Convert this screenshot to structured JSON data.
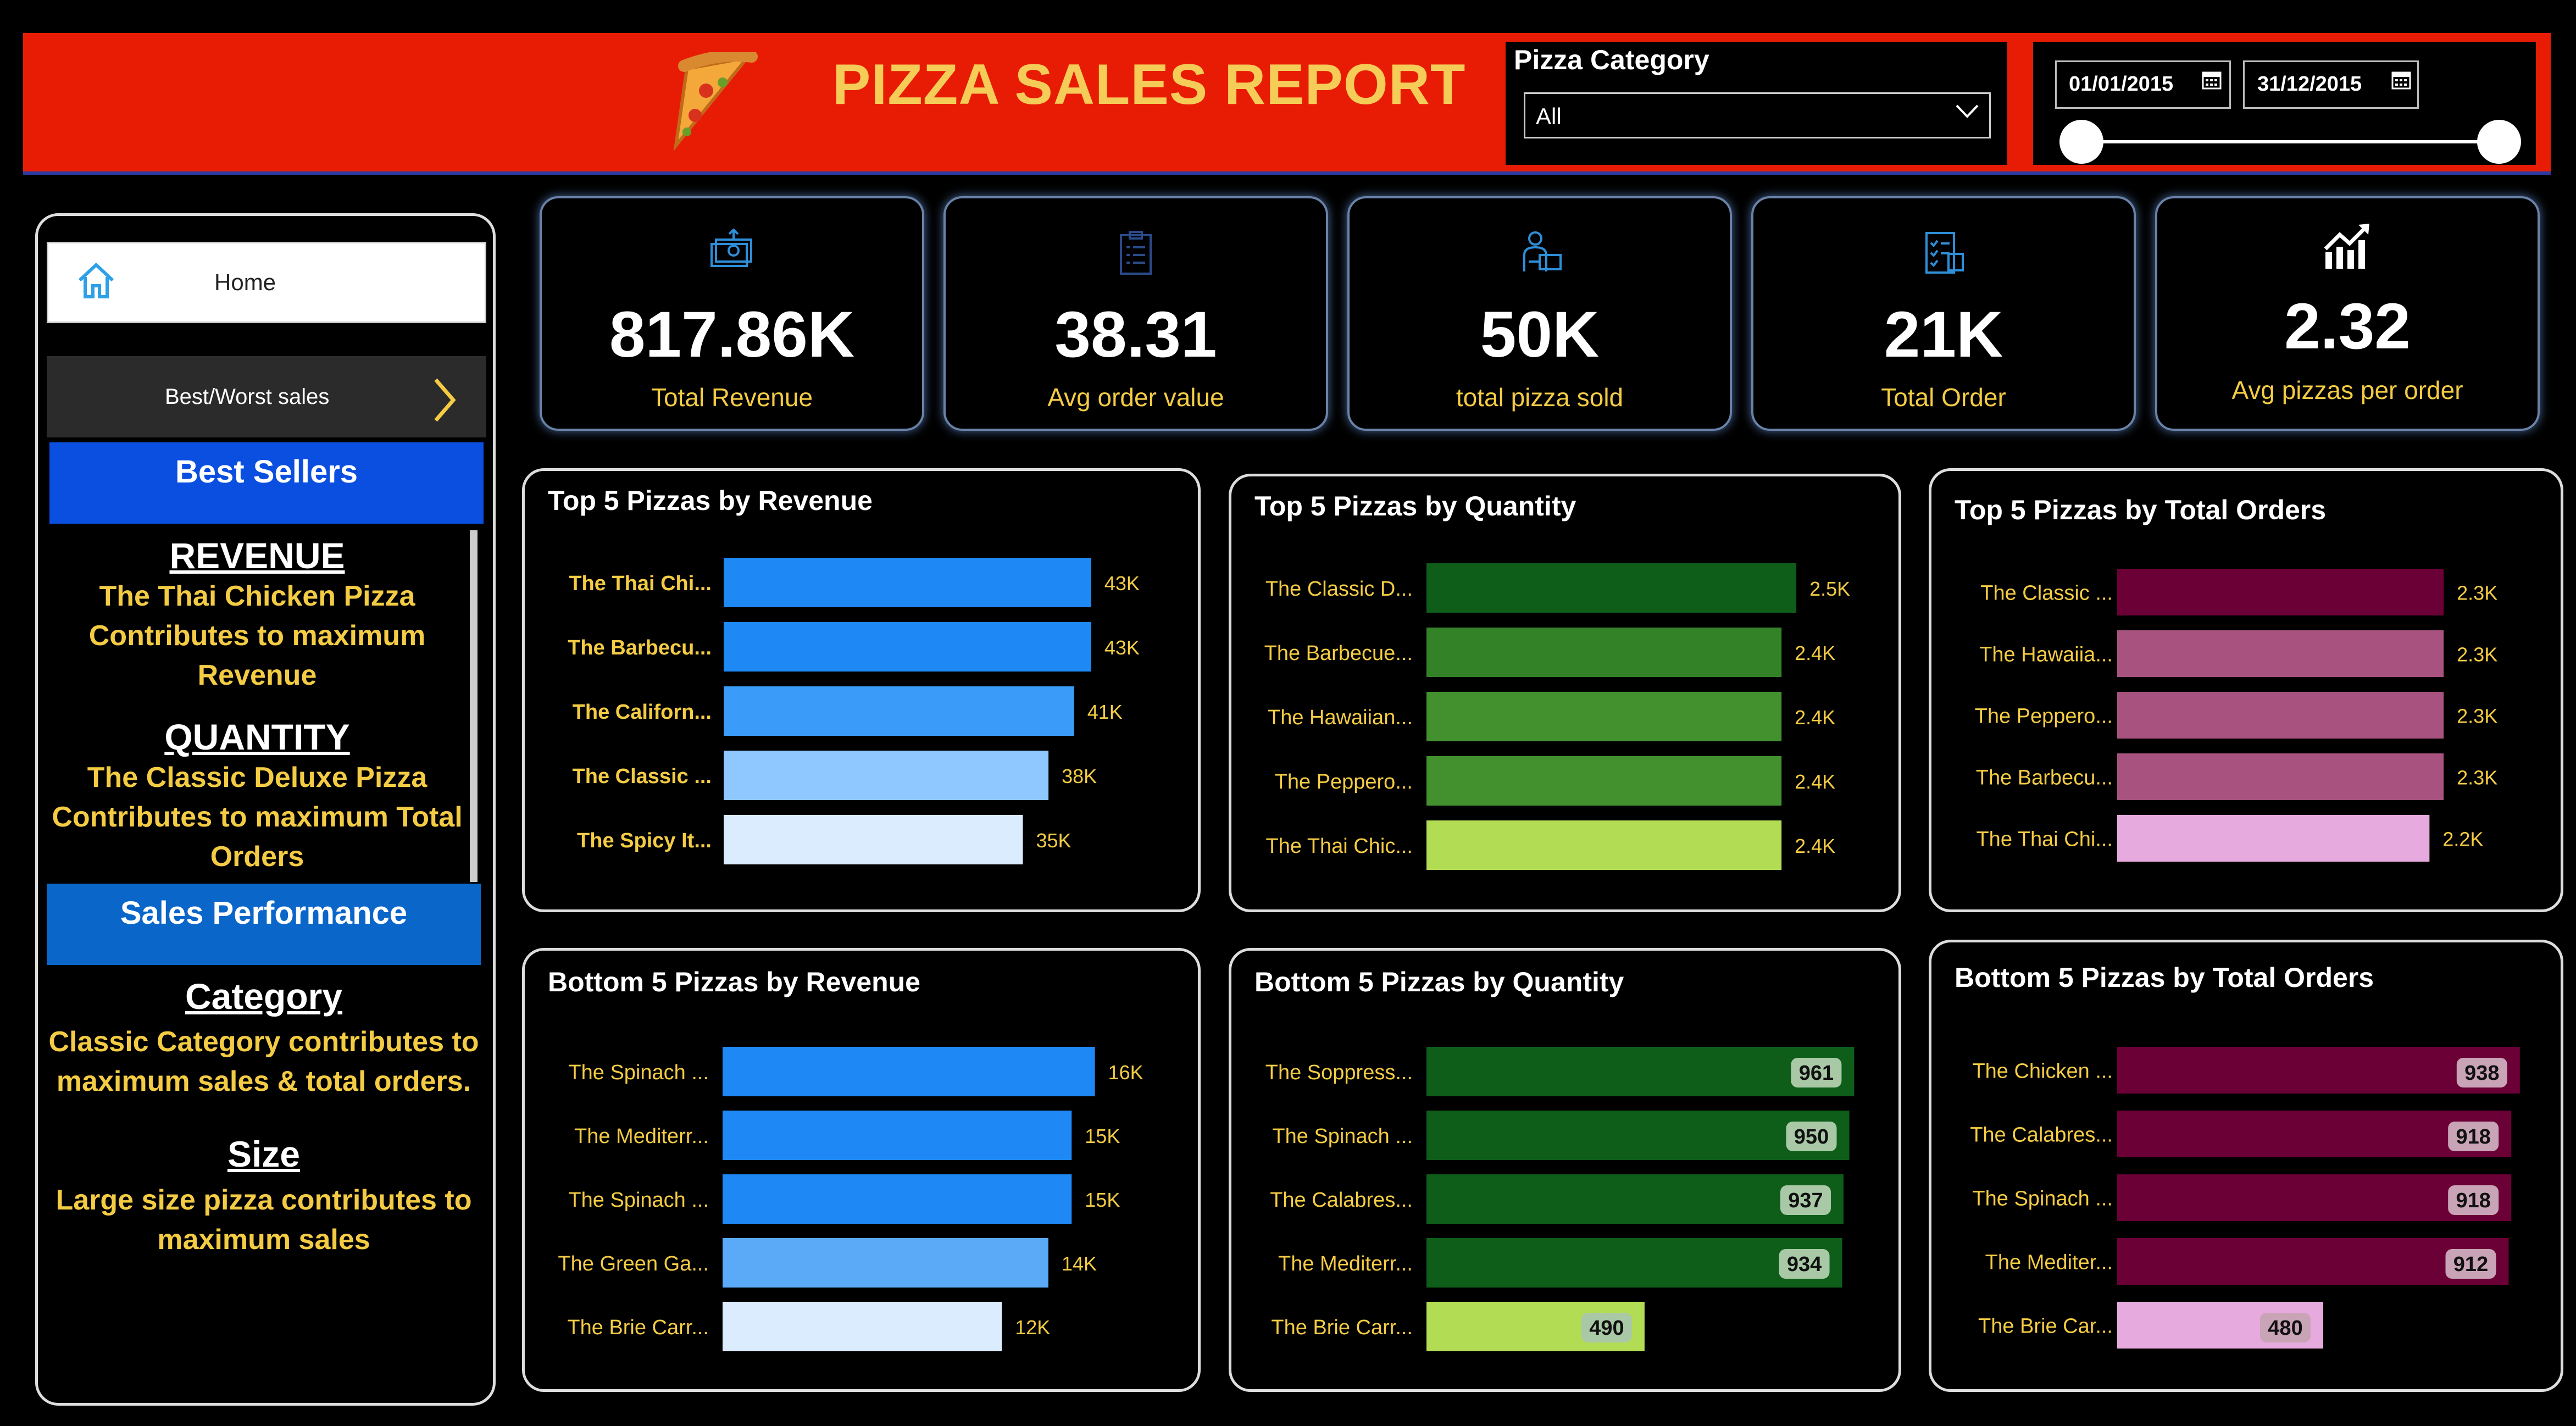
{
  "header": {
    "title": "PIZZA SALES REPORT",
    "category_filter": {
      "label": "Pizza Category",
      "selected": "All"
    },
    "date_range": {
      "start": "01/01/2015",
      "end": "31/12/2015"
    }
  },
  "sidebar": {
    "home_label": "Home",
    "best_worst_label": "Best/Worst sales",
    "best_sellers_label": "Best Sellers",
    "revenue_heading": "REVENUE",
    "revenue_text": "The Thai Chicken Pizza Contributes to maximum Revenue",
    "quantity_heading": "QUANTITY",
    "quantity_text": "The Classic Deluxe Pizza Contributes to maximum Total Orders",
    "sales_performance_label": "Sales Performance",
    "category_heading": "Category",
    "category_text": "Classic Category contributes to maximum sales & total orders.",
    "size_heading": "Size",
    "size_text": "Large size pizza contributes to maximum sales"
  },
  "kpis": [
    {
      "value": "817.86K",
      "label": "Total Revenue",
      "icon": "money-icon"
    },
    {
      "value": "38.31",
      "label": "Avg order value",
      "icon": "clipboard-icon"
    },
    {
      "value": "50K",
      "label": "total pizza sold",
      "icon": "delivery-icon"
    },
    {
      "value": "21K",
      "label": "Total Order",
      "icon": "checklist-icon"
    },
    {
      "value": "2.32",
      "label": "Avg pizzas per order",
      "icon": "growth-chart-icon"
    }
  ],
  "chart_data": [
    {
      "type": "bar",
      "orientation": "horizontal",
      "title": "Top 5 Pizzas by Revenue",
      "categories": [
        "The Thai Chi...",
        "The Barbecu...",
        "The Californ...",
        "The Classic ...",
        "The Spicy It..."
      ],
      "values": [
        43000,
        43000,
        41000,
        38000,
        35000
      ],
      "labels": [
        "43K",
        "43K",
        "41K",
        "38K",
        "35K"
      ],
      "colors": [
        "#1e88f5",
        "#1e88f5",
        "#3a9cf8",
        "#8ec8ff",
        "#dcecff"
      ],
      "label_style": "plain",
      "label_bold": true
    },
    {
      "type": "bar",
      "orientation": "horizontal",
      "title": "Top 5 Pizzas by Quantity",
      "categories": [
        "The Classic D...",
        "The Barbecue...",
        "The Hawaiian...",
        "The Peppero...",
        "The Thai Chic..."
      ],
      "values": [
        2500,
        2400,
        2400,
        2400,
        2400
      ],
      "labels": [
        "2.5K",
        "2.4K",
        "2.4K",
        "2.4K",
        "2.4K"
      ],
      "colors": [
        "#0e5e1a",
        "#348228",
        "#42912e",
        "#42912e",
        "#b3dc55"
      ],
      "label_style": "plain",
      "label_bold": false
    },
    {
      "type": "bar",
      "orientation": "horizontal",
      "title": "Top 5 Pizzas by Total Orders",
      "categories": [
        "The Classic ...",
        "The Hawaiia...",
        "The Peppero...",
        "The Barbecu...",
        "The Thai Chi..."
      ],
      "values": [
        2300,
        2300,
        2300,
        2300,
        2200
      ],
      "labels": [
        "2.3K",
        "2.3K",
        "2.3K",
        "2.3K",
        "2.2K"
      ],
      "colors": [
        "#6b0036",
        "#a8527f",
        "#a8527f",
        "#a8527f",
        "#e6aade"
      ],
      "label_style": "plain",
      "label_bold": false
    },
    {
      "type": "bar",
      "orientation": "horizontal",
      "title": "Bottom 5 Pizzas by Revenue",
      "categories": [
        "The Spinach ...",
        "The Mediterr...",
        "The Spinach ...",
        "The Green Ga...",
        "The Brie Carr..."
      ],
      "values": [
        16000,
        15000,
        15000,
        14000,
        12000
      ],
      "labels": [
        "16K",
        "15K",
        "15K",
        "14K",
        "12K"
      ],
      "colors": [
        "#1e88f5",
        "#1e88f5",
        "#1e88f5",
        "#5aaaf8",
        "#dcecff"
      ],
      "label_style": "plain",
      "label_bold": false
    },
    {
      "type": "bar",
      "orientation": "horizontal",
      "title": "Bottom 5 Pizzas by Quantity",
      "categories": [
        "The Soppress...",
        "The Spinach ...",
        "The Calabres...",
        "The Mediterr...",
        "The Brie Carr..."
      ],
      "values": [
        961,
        950,
        937,
        934,
        490
      ],
      "labels": [
        "961",
        "950",
        "937",
        "934",
        "490"
      ],
      "colors": [
        "#0e5e1a",
        "#0e5e1a",
        "#0e5e1a",
        "#0e5e1a",
        "#b3dc55"
      ],
      "label_style": "badge",
      "label_bold": true
    },
    {
      "type": "bar",
      "orientation": "horizontal",
      "title": "Bottom 5 Pizzas by Total Orders",
      "categories": [
        "The Chicken ...",
        "The Calabres...",
        "The Spinach ...",
        "The Mediter...",
        "The Brie Car..."
      ],
      "values": [
        938,
        918,
        918,
        912,
        480
      ],
      "labels": [
        "938",
        "918",
        "918",
        "912",
        "480"
      ],
      "colors": [
        "#6b0036",
        "#6b0036",
        "#6b0036",
        "#6b0036",
        "#e6aade"
      ],
      "label_style": "badge",
      "label_bold": true
    }
  ]
}
